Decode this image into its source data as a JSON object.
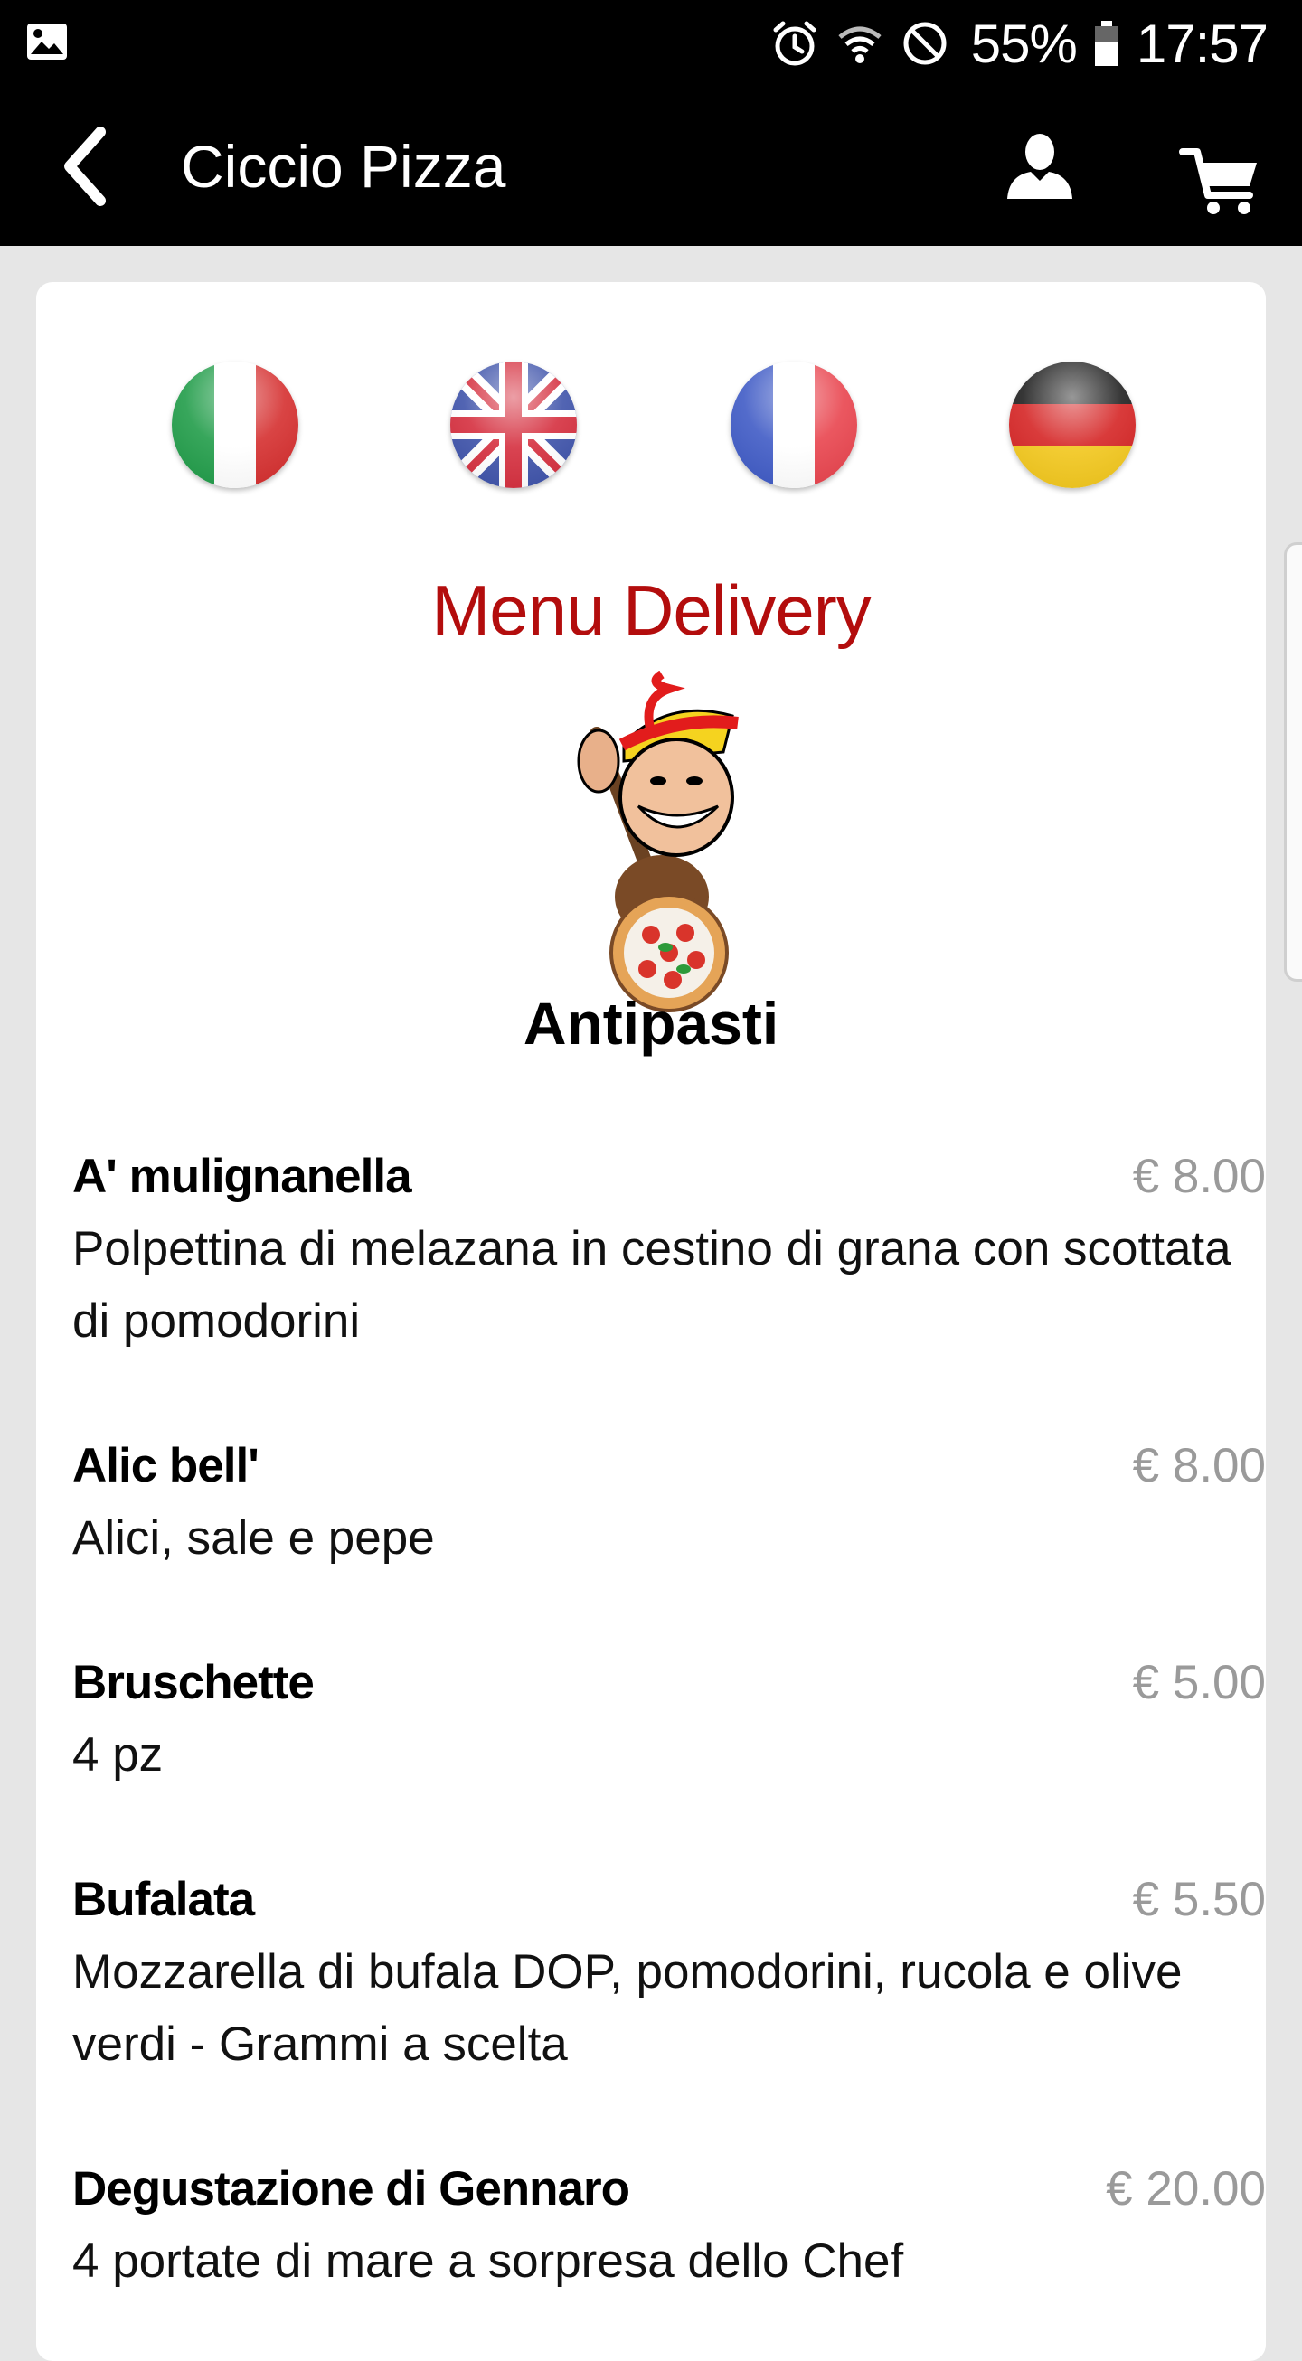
{
  "status_bar": {
    "battery": "55%",
    "clock": "17:57",
    "icons": [
      "gallery-icon",
      "alarm-icon",
      "wifi-icon",
      "do-not-disturb-icon",
      "battery-icon"
    ]
  },
  "app_bar": {
    "title": "Ciccio Pizza",
    "cart_count": "0",
    "icons": [
      "back-arrow-icon",
      "account-icon",
      "cart-icon"
    ]
  },
  "languages": [
    "it",
    "en",
    "fr",
    "de"
  ],
  "menu": {
    "title": "Menu Delivery",
    "category": "Antipasti",
    "items": [
      {
        "name": "A' mulignanella",
        "price": "€ 8.00",
        "description": "Polpettina di melazana in cestino di grana con scottata di pomodorini"
      },
      {
        "name": "Alic bell'",
        "price": "€ 8.00",
        "description": "Alici, sale e pepe"
      },
      {
        "name": "Bruschette",
        "price": "€ 5.00",
        "description": "4 pz"
      },
      {
        "name": "Bufalata",
        "price": "€ 5.50",
        "description": "Mozzarella di bufala DOP, pomodorini, rucola e olive verdi - Grammi a scelta"
      },
      {
        "name": "Degustazione di Gennaro",
        "price": "€ 20.00",
        "description": "4 portate di mare a sorpresa dello Chef"
      }
    ]
  },
  "colors": {
    "title_red": "#b30d0d",
    "price_gray": "#9a9a9a",
    "badge_red": "#cc0000",
    "badge_text": "#ffcc00"
  }
}
